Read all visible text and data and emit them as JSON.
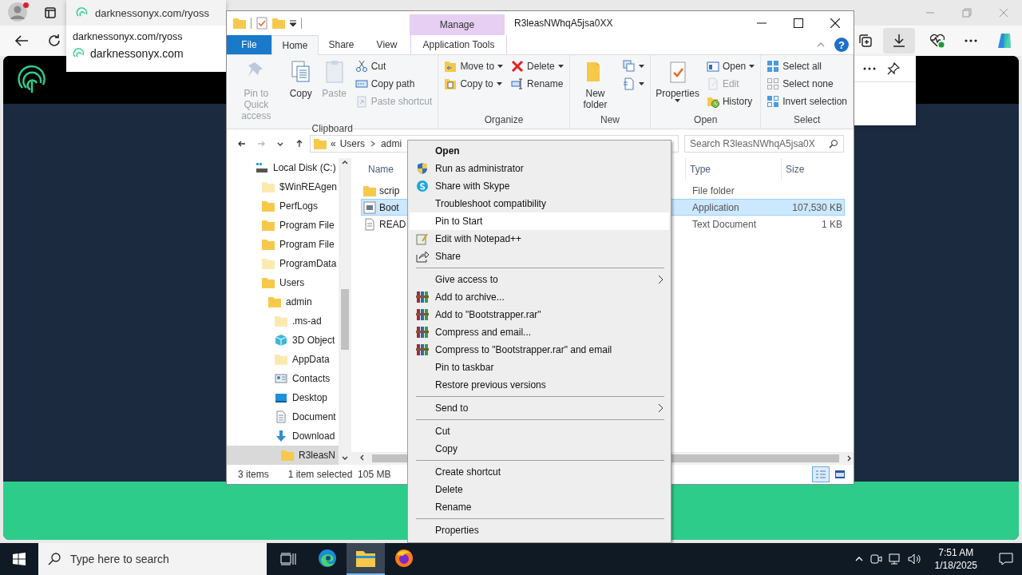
{
  "browser": {
    "tab": {
      "title": "darknessonyx.com/ryoss"
    },
    "hover_card": {
      "url": "darknessonyx.com/ryoss",
      "site": "darknessonyx.com"
    }
  },
  "explorer": {
    "title": "R3leasNWhqA5jsa0XX",
    "contextual_tab": "Manage",
    "help": "?",
    "tabs": [
      {
        "label": "File",
        "kind": "file",
        "selected": false
      },
      {
        "label": "Home",
        "kind": "tab",
        "selected": true
      },
      {
        "label": "Share",
        "kind": "tab",
        "selected": false
      },
      {
        "label": "View",
        "kind": "tab",
        "selected": false
      },
      {
        "label": "Application Tools",
        "kind": "contextual",
        "selected": false
      }
    ],
    "ribbon": [
      {
        "name": "Clipboard",
        "columns": [
          [
            {
              "label": "Pin to Quick access",
              "kind": "large",
              "disabled": true,
              "dropdown": false
            }
          ],
          [
            {
              "label": "Copy",
              "kind": "large",
              "disabled": false,
              "dropdown": false
            }
          ],
          [
            {
              "label": "Paste",
              "kind": "large",
              "disabled": true,
              "dropdown": false
            }
          ],
          [
            {
              "label": "Cut",
              "kind": "small",
              "disabled": false,
              "dropdown": false
            },
            {
              "label": "Copy path",
              "kind": "small",
              "disabled": false,
              "dropdown": false
            },
            {
              "label": "Paste shortcut",
              "kind": "small",
              "disabled": true,
              "dropdown": false
            }
          ]
        ]
      },
      {
        "name": "Organize",
        "columns": [
          [
            {
              "label": "Move to",
              "kind": "small",
              "disabled": false,
              "dropdown": true
            },
            {
              "label": "Copy to",
              "kind": "small",
              "disabled": false,
              "dropdown": true
            }
          ],
          [
            {
              "label": "Delete",
              "kind": "small",
              "disabled": false,
              "dropdown": true
            },
            {
              "label": "Rename",
              "kind": "small",
              "disabled": false,
              "dropdown": false
            }
          ]
        ]
      },
      {
        "name": "New",
        "columns": [
          [
            {
              "label": "New folder",
              "kind": "large",
              "disabled": false,
              "dropdown": false
            }
          ],
          [
            {
              "kind": "icon",
              "disabled": false,
              "dropdown": true
            },
            {
              "kind": "icon",
              "disabled": false,
              "dropdown": true
            }
          ]
        ]
      },
      {
        "name": "Open",
        "columns": [
          [
            {
              "label": "Properties",
              "kind": "large",
              "disabled": false,
              "dropdown": true
            }
          ],
          [
            {
              "label": "Open",
              "kind": "small",
              "disabled": false,
              "dropdown": true
            },
            {
              "label": "Edit",
              "kind": "small",
              "disabled": true,
              "dropdown": false
            },
            {
              "label": "History",
              "kind": "small",
              "disabled": false,
              "dropdown": false
            }
          ]
        ]
      },
      {
        "name": "Select",
        "columns": [
          [
            {
              "label": "Select all",
              "kind": "small",
              "disabled": false,
              "dropdown": false
            },
            {
              "label": "Select none",
              "kind": "small",
              "disabled": false,
              "dropdown": false
            },
            {
              "label": "Invert selection",
              "kind": "small",
              "disabled": false,
              "dropdown": false
            }
          ]
        ]
      }
    ],
    "address": {
      "crumbs": [
        "«",
        "Users",
        "admi"
      ]
    },
    "search": {
      "placeholder": "Search R3leasNWhqA5jsa0X"
    },
    "nav_tree": [
      {
        "label": "Local Disk (C:)",
        "selected": false,
        "children": [
          {
            "label": "$WinREAgen",
            "selected": false
          },
          {
            "label": "PerfLogs",
            "selected": false
          },
          {
            "label": "Program File",
            "selected": false
          },
          {
            "label": "Program File",
            "selected": false
          },
          {
            "label": "ProgramData",
            "selected": false
          },
          {
            "label": "Users",
            "selected": false,
            "children": [
              {
                "label": "admin",
                "selected": false,
                "children": [
                  {
                    "label": ".ms-ad",
                    "selected": false
                  },
                  {
                    "label": "3D Object",
                    "selected": false
                  },
                  {
                    "label": "AppData",
                    "selected": false
                  },
                  {
                    "label": "Contacts",
                    "selected": false
                  },
                  {
                    "label": "Desktop",
                    "selected": false
                  },
                  {
                    "label": "Document",
                    "selected": false
                  },
                  {
                    "label": "Download",
                    "selected": false,
                    "children": [
                      {
                        "label": "R3leasN",
                        "selected": true
                      }
                    ]
                  }
                ]
              }
            ]
          }
        ]
      }
    ],
    "files": {
      "columns": [
        "Name",
        "Type",
        "Size"
      ],
      "rows": [
        {
          "name": "scrip",
          "kind": "folder",
          "type": "File folder",
          "selected": false
        },
        {
          "name": "Boot",
          "kind": "app",
          "type": "Application",
          "size": "107,530 KB",
          "selected": true
        },
        {
          "name": "READ",
          "kind": "text",
          "type": "Text Document",
          "size": "1 KB",
          "selected": false
        }
      ]
    },
    "status": {
      "count": "3 items",
      "selection": "1 item selected",
      "size": "105 MB"
    },
    "view_buttons": [
      {
        "selected": true
      },
      {
        "selected": false
      }
    ]
  },
  "context_menu": [
    {
      "kind": "item",
      "label": "Open",
      "default": true,
      "submenu": false,
      "selected": false
    },
    {
      "kind": "item",
      "label": "Run as administrator",
      "default": false,
      "submenu": false,
      "selected": false
    },
    {
      "kind": "item",
      "label": "Share with Skype",
      "default": false,
      "submenu": false,
      "selected": false
    },
    {
      "kind": "item",
      "label": "Troubleshoot compatibility",
      "default": false,
      "submenu": false,
      "selected": false
    },
    {
      "kind": "item",
      "label": "Pin to Start",
      "default": false,
      "submenu": false,
      "selected": true
    },
    {
      "kind": "item",
      "label": "Edit with Notepad++",
      "default": false,
      "submenu": false,
      "selected": false
    },
    {
      "kind": "item",
      "label": "Share",
      "default": false,
      "submenu": false,
      "selected": false
    },
    {
      "kind": "separator"
    },
    {
      "kind": "item",
      "label": "Give access to",
      "default": false,
      "submenu": true,
      "selected": false
    },
    {
      "kind": "item",
      "label": "Add to archive...",
      "default": false,
      "submenu": false,
      "selected": false
    },
    {
      "kind": "item",
      "label": "Add to \"Bootstrapper.rar\"",
      "default": false,
      "submenu": false,
      "selected": false
    },
    {
      "kind": "item",
      "label": "Compress and email...",
      "default": false,
      "submenu": false,
      "selected": false
    },
    {
      "kind": "item",
      "label": "Compress to \"Bootstrapper.rar\" and email",
      "default": false,
      "submenu": false,
      "selected": false
    },
    {
      "kind": "item",
      "label": "Pin to taskbar",
      "default": false,
      "submenu": false,
      "selected": false
    },
    {
      "kind": "item",
      "label": "Restore previous versions",
      "default": false,
      "submenu": false,
      "selected": false
    },
    {
      "kind": "separator"
    },
    {
      "kind": "item",
      "label": "Send to",
      "default": false,
      "submenu": true,
      "selected": false
    },
    {
      "kind": "separator"
    },
    {
      "kind": "item",
      "label": "Cut",
      "default": false,
      "submenu": false,
      "selected": false
    },
    {
      "kind": "item",
      "label": "Copy",
      "default": false,
      "submenu": false,
      "selected": false
    },
    {
      "kind": "separator"
    },
    {
      "kind": "item",
      "label": "Create shortcut",
      "default": false,
      "submenu": false,
      "selected": false
    },
    {
      "kind": "item",
      "label": "Delete",
      "default": false,
      "submenu": false,
      "selected": false
    },
    {
      "kind": "item",
      "label": "Rename",
      "default": false,
      "submenu": false,
      "selected": false
    },
    {
      "kind": "separator"
    },
    {
      "kind": "item",
      "label": "Properties",
      "default": false,
      "submenu": false,
      "selected": false
    }
  ],
  "taskbar": {
    "search_placeholder": "Type here to search",
    "apps": [
      {
        "selected": false
      },
      {
        "selected": true
      },
      {
        "selected": false
      }
    ],
    "clock": {
      "time": "7:51 AM",
      "date": "1/18/2025"
    }
  }
}
